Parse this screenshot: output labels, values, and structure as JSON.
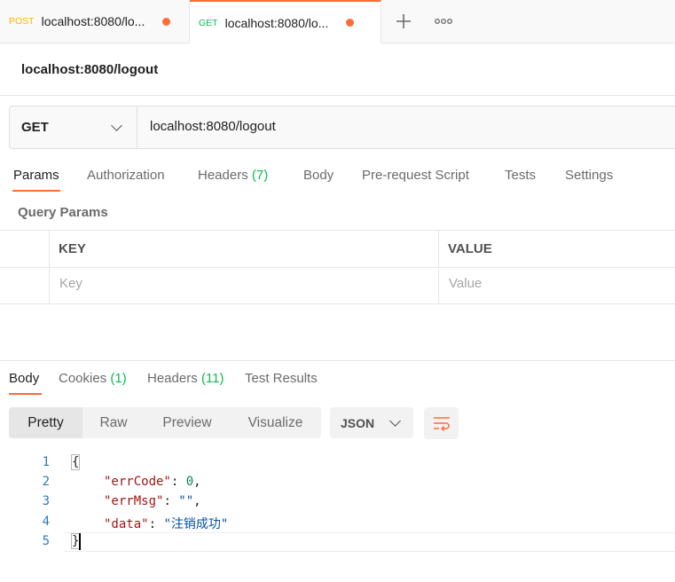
{
  "tabs": [
    {
      "method": "POST",
      "method_color": "#ffb400",
      "title": "localhost:8080/lo..."
    },
    {
      "method": "GET",
      "method_color": "#0cbb52",
      "title": "localhost:8080/lo..."
    }
  ],
  "tab_actions": {
    "new_tab": "+",
    "more": "∘∘∘"
  },
  "request": {
    "name": "localhost:8080/logout",
    "method": "GET",
    "url": "localhost:8080/logout"
  },
  "request_tabs": [
    {
      "label": "Params"
    },
    {
      "label": "Authorization"
    },
    {
      "label": "Headers",
      "count": "(7)"
    },
    {
      "label": "Body"
    },
    {
      "label": "Pre-request Script"
    },
    {
      "label": "Tests"
    },
    {
      "label": "Settings"
    }
  ],
  "query_params": {
    "title": "Query Params",
    "col_key": "KEY",
    "col_value": "VALUE",
    "key_placeholder": "Key",
    "value_placeholder": "Value"
  },
  "response_tabs": [
    {
      "label": "Body"
    },
    {
      "label": "Cookies",
      "count": "(1)"
    },
    {
      "label": "Headers",
      "count": "(11)"
    },
    {
      "label": "Test Results"
    }
  ],
  "view_modes": [
    "Pretty",
    "Raw",
    "Preview",
    "Visualize"
  ],
  "format": "JSON",
  "code": {
    "line_numbers": [
      "1",
      "2",
      "3",
      "4",
      "5"
    ],
    "open_brace": "{",
    "close_brace": "}",
    "fields": [
      {
        "key": "\"errCode\"",
        "colon": ": ",
        "value": "0",
        "type": "number",
        "trail": ","
      },
      {
        "key": "\"errMsg\"",
        "colon": ": ",
        "value": "\"\"",
        "type": "string",
        "trail": ","
      },
      {
        "key": "\"data\"",
        "colon": ": ",
        "value": "\"注销成功\"",
        "type": "string",
        "trail": ""
      }
    ]
  },
  "colors": {
    "accent": "#ff6c37",
    "count_green": "#0cbb52"
  }
}
